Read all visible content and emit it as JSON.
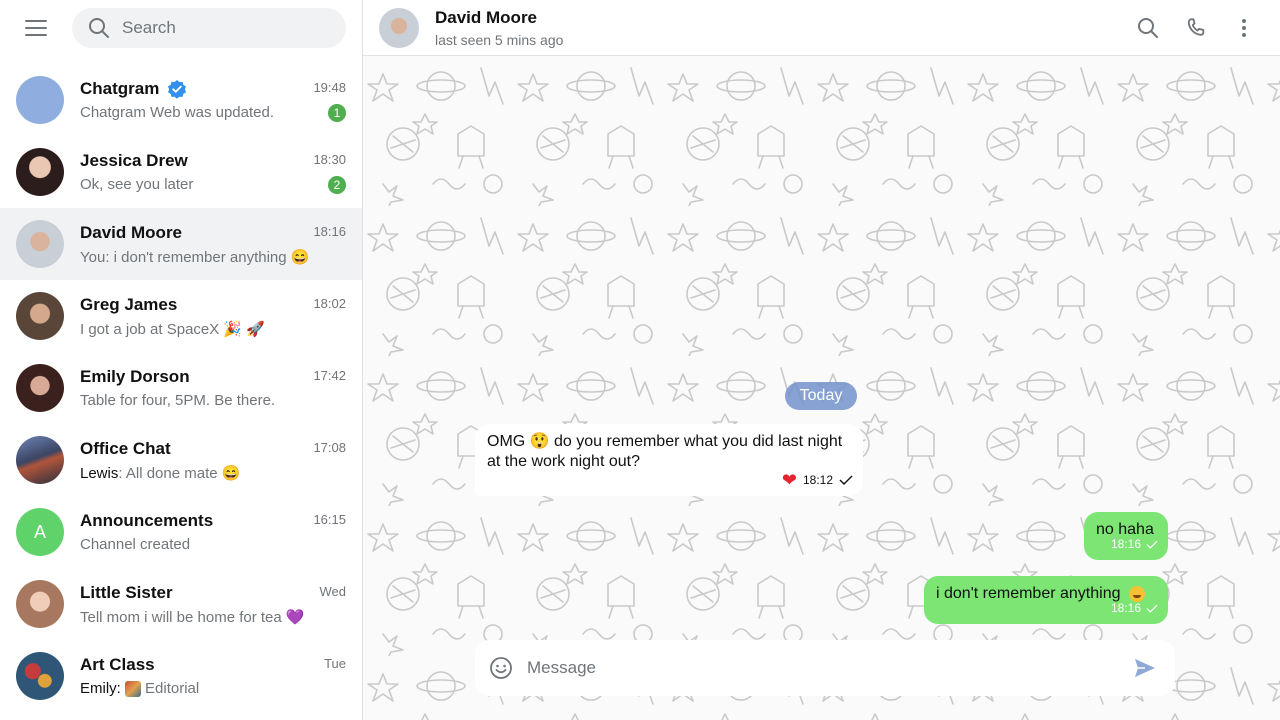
{
  "sidebar": {
    "search_placeholder": "Search",
    "chats": [
      {
        "name": "Chatgram",
        "time": "19:48",
        "preview": "Chatgram Web was updated.",
        "badge": "1",
        "verified": true,
        "avatar_color": "#8faddf"
      },
      {
        "name": "Jessica Drew",
        "time": "18:30",
        "preview": "Ok, see you later",
        "badge": "2",
        "avatar_color": "#6b4b45"
      },
      {
        "name": "David Moore",
        "time": "18:16",
        "preview": "You: i don't remember anything 😄",
        "avatar_color": "#b7c0c8",
        "active": true
      },
      {
        "name": "Greg James",
        "time": "18:02",
        "preview": "I got a job at SpaceX 🎉 🚀",
        "avatar_color": "#6e584b"
      },
      {
        "name": "Emily Dorson",
        "time": "17:42",
        "preview": "Table for four, 5PM. Be there.",
        "avatar_color": "#4b2f2b"
      },
      {
        "name": "Office Chat",
        "time": "17:08",
        "preview_sender": "Lewis",
        "preview": ": All done mate 😄",
        "avatar_color": "#3d4560"
      },
      {
        "name": "Announcements",
        "time": "16:15",
        "preview": "Channel created",
        "avatar_letter": "A",
        "avatar_color": "#5fd269"
      },
      {
        "name": "Little Sister",
        "time": "Wed",
        "preview": "Tell mom i will be home for tea 💜",
        "avatar_color": "#c79f8e"
      },
      {
        "name": "Art Class",
        "time": "Tue",
        "preview_sender": "Emily",
        "preview": "Editorial",
        "avatar_color": "#3a5a7a"
      }
    ]
  },
  "header": {
    "name": "David Moore",
    "status": "last seen 5 mins ago"
  },
  "conversation": {
    "date_label": "Today",
    "messages": [
      {
        "direction": "in",
        "text": "OMG 😲 do you remember what you did last night at the work night out?",
        "time": "18:12",
        "reaction": "❤"
      },
      {
        "direction": "out",
        "text": "no haha",
        "time": "18:16"
      },
      {
        "direction": "out",
        "text": "i don't remember anything",
        "time": "18:16"
      }
    ]
  },
  "composer": {
    "placeholder": "Message"
  },
  "colors": {
    "accent": "#4fae4e",
    "outgoing_bubble": "#7ce574",
    "date_pill": "#7392cd",
    "verified": "#3390ec"
  }
}
